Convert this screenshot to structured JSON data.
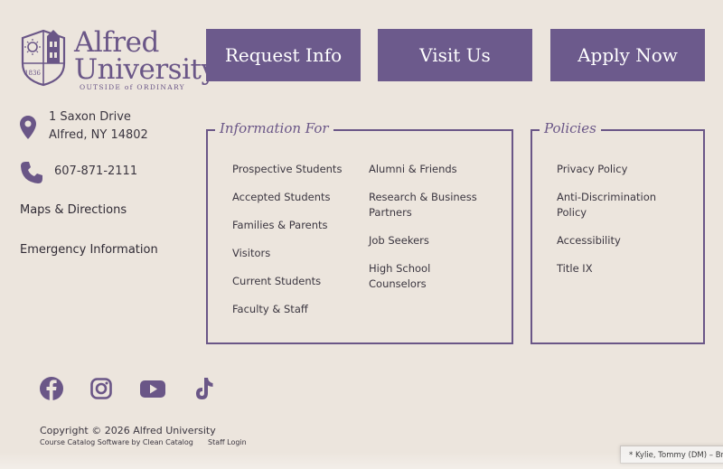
{
  "brand": {
    "name_line1": "Alfred",
    "name_line2": "University",
    "tagline": "OUTSIDE of ORDINARY",
    "seal_year": "1836",
    "color": "#6a5687"
  },
  "cta": {
    "request_info": "Request Info",
    "visit_us": "Visit Us",
    "apply_now": "Apply Now",
    "bg_color": "#6c5a8c"
  },
  "contact": {
    "address_line1": "1 Saxon Drive",
    "address_line2": "Alfred, NY 14802",
    "phone": "607-871-2111",
    "address_icon": "map-pin-icon",
    "phone_icon": "phone-icon"
  },
  "sidebar_links": {
    "maps": "Maps & Directions",
    "emergency": "Emergency Information"
  },
  "information_for": {
    "heading": "Information For",
    "col1": [
      "Prospective Students",
      "Accepted Students",
      "Families & Parents",
      "Visitors",
      "Current Students",
      "Faculty & Staff"
    ],
    "col2": [
      "Alumni & Friends",
      "Research & Business Partners",
      "Job Seekers",
      "High School Counselors"
    ]
  },
  "policies": {
    "heading": "Policies",
    "items": [
      "Privacy Policy",
      "Anti-Discrimination Policy",
      "Accessibility",
      "Title IX"
    ]
  },
  "social": [
    "facebook-icon",
    "instagram-icon",
    "youtube-icon",
    "tiktok-icon"
  ],
  "footer": {
    "copyright": "Copyright © 2026 Alfred University",
    "catalog_software": "Course Catalog Software by Clean Catalog",
    "staff_login": "Staff Login"
  },
  "user_badge": "* Kylie, Tommy (DM) – Bril"
}
